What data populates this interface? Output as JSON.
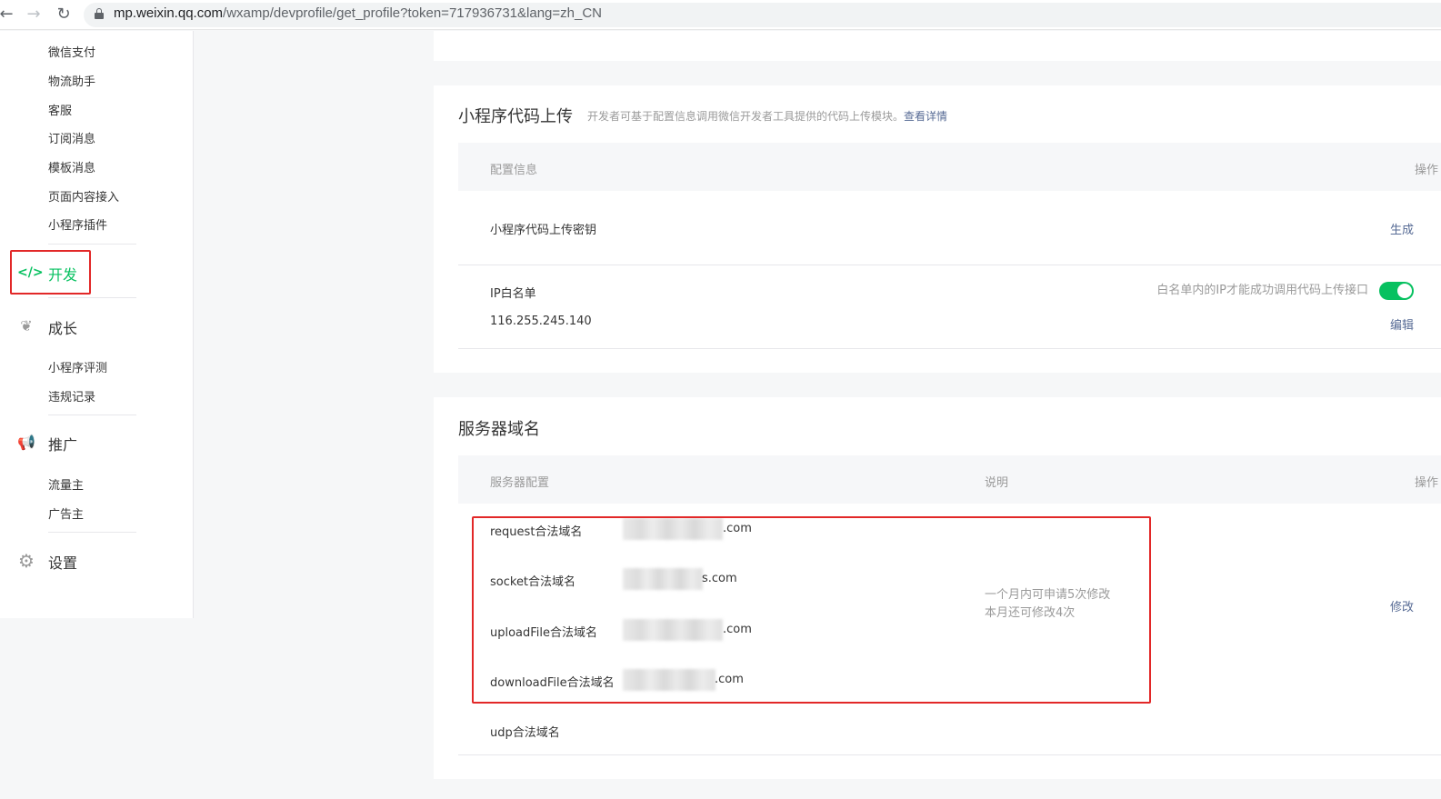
{
  "browser": {
    "url_host": "mp.weixin.qq.com",
    "url_rest": "/wxamp/devprofile/get_profile?token=717936731&lang=zh_CN"
  },
  "sidebar": {
    "top_items": [
      "微信支付",
      "物流助手",
      "客服",
      "订阅消息",
      "模板消息",
      "页面内容接入",
      "小程序插件"
    ],
    "dev_label": "开发",
    "growth_label": "成长",
    "growth_items": [
      "小程序评测",
      "违规记录"
    ],
    "promo_label": "推广",
    "promo_items": [
      "流量主",
      "广告主"
    ],
    "settings_label": "设置"
  },
  "upload_panel": {
    "title": "小程序代码上传",
    "desc": "开发者可基于配置信息调用微信开发者工具提供的代码上传模块。",
    "desc_link": "查看详情",
    "head_config": "配置信息",
    "head_action": "操作",
    "key_label": "小程序代码上传密钥",
    "key_action": "生成",
    "ip_label": "IP白名单",
    "ip_value": "116.255.245.140",
    "ip_hint": "白名单内的IP才能成功调用代码上传接口",
    "ip_toggle_on": true,
    "ip_action": "编辑"
  },
  "server_panel": {
    "title": "服务器域名",
    "head_config": "服务器配置",
    "head_desc": "说明",
    "head_action": "操作",
    "domains": [
      {
        "label": "request合法域名",
        "suffix": ".com"
      },
      {
        "label": "socket合法域名",
        "suffix": "s.com"
      },
      {
        "label": "uploadFile合法域名",
        "suffix": ".com"
      },
      {
        "label": "downloadFile合法域名",
        "suffix": ".com"
      }
    ],
    "udp_label": "udp合法域名",
    "note_line1": "一个月内可申请5次修改",
    "note_line2": "本月还可修改4次",
    "action": "修改"
  },
  "colors": {
    "accent_green": "#07c160",
    "link_blue": "#576b95",
    "highlight_red": "#e22828"
  }
}
